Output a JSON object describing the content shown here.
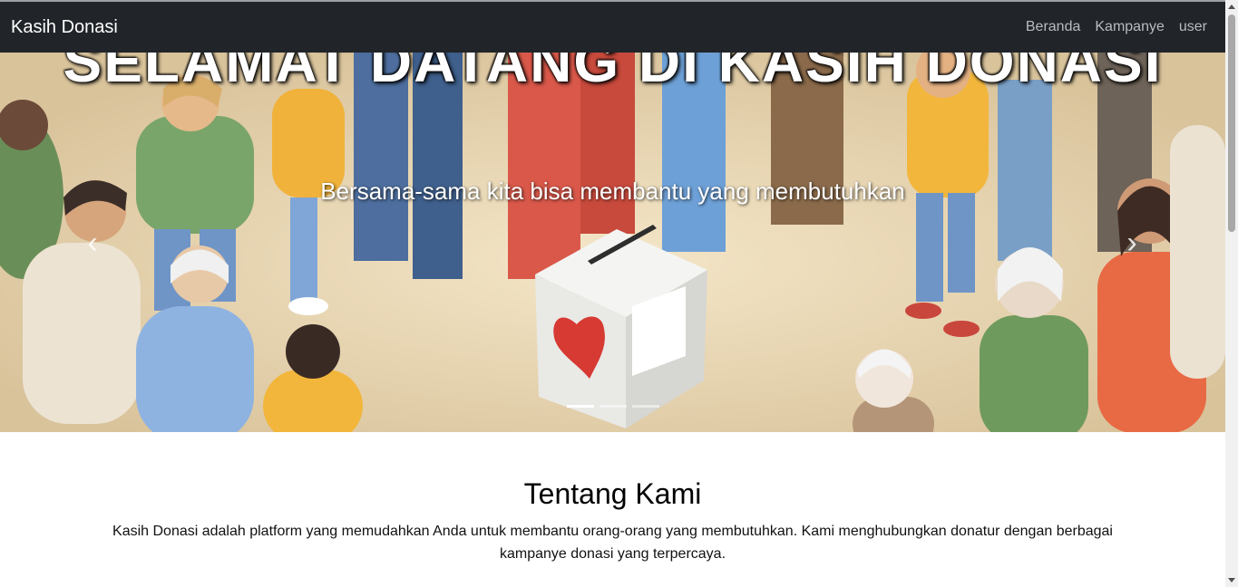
{
  "navbar": {
    "brand": "Kasih Donasi",
    "links": [
      "Beranda",
      "Kampanye",
      "user"
    ]
  },
  "hero": {
    "title": "SELAMAT DATANG DI KASIH DONASI",
    "subtitle": "Bersama-sama kita bisa membantu yang membutuhkan",
    "prev_icon": "chevron-left-icon",
    "next_icon": "chevron-right-icon",
    "slide_count": 3,
    "active_slide": 1
  },
  "about": {
    "heading": "Tentang Kami",
    "text": "Kasih Donasi adalah platform yang memudahkan Anda untuk membantu orang-orang yang membutuhkan. Kami menghubungkan donatur dengan berbagai kampanye donasi yang terpercaya."
  },
  "colors": {
    "navbar_bg": "#212529",
    "nav_link": "#b8bcc0",
    "hero_floor": "#ead9b8"
  }
}
